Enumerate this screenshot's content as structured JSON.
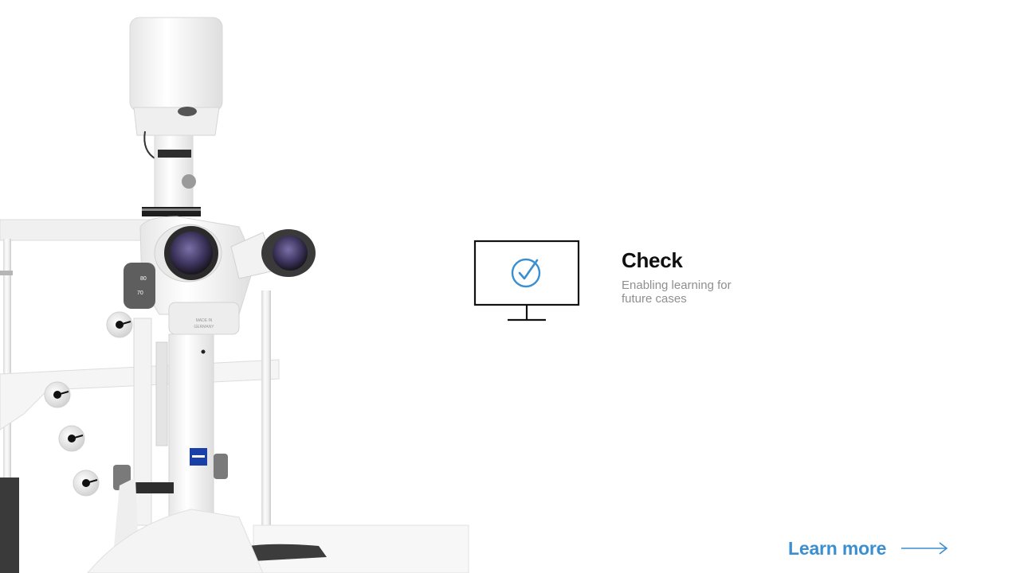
{
  "feature": {
    "title": "Check",
    "description": "Enabling learning for future cases",
    "icon": "monitor-check-icon"
  },
  "cta": {
    "label": "Learn more",
    "icon": "arrow-right-icon"
  },
  "device": {
    "badges": [
      "80",
      "70"
    ],
    "origin_label": "MADE IN GERMANY",
    "brand_logo": "ZEISS"
  },
  "colors": {
    "accent": "#3a8fd1",
    "background": "#ffffff",
    "title": "#101010",
    "description": "#8f8f8f",
    "icon_stroke": "#111111",
    "brand_badge": "#1a3fa8"
  }
}
